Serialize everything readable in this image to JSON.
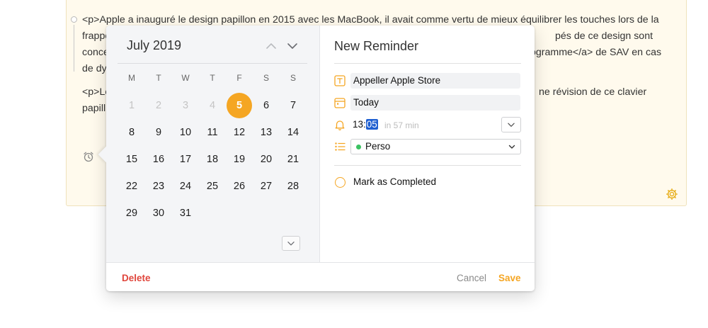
{
  "note": {
    "lines": [
      "<p>Apple a inauguré le design papillon en 2015 avec les MacBook, il avait comme vertu de mieux équilibrer les touches lors de la",
      "frappe",
      "pés de ce design sont",
      "conce",
      "ogramme</a> de SAV en cas",
      "de dy",
      "<p>Le",
      "ne révision de ce clavier",
      "papill"
    ]
  },
  "calendar": {
    "month_label": "July 2019",
    "weekdays": [
      "M",
      "T",
      "W",
      "T",
      "F",
      "S",
      "S"
    ],
    "weeks": [
      [
        {
          "d": "1",
          "muted": true
        },
        {
          "d": "2",
          "muted": true
        },
        {
          "d": "3",
          "muted": true
        },
        {
          "d": "4",
          "muted": true
        },
        {
          "d": "5",
          "selected": true
        },
        {
          "d": "6"
        },
        {
          "d": "7"
        }
      ],
      [
        {
          "d": "8"
        },
        {
          "d": "9"
        },
        {
          "d": "10"
        },
        {
          "d": "11"
        },
        {
          "d": "12"
        },
        {
          "d": "13"
        },
        {
          "d": "14"
        }
      ],
      [
        {
          "d": "15"
        },
        {
          "d": "16"
        },
        {
          "d": "17"
        },
        {
          "d": "18"
        },
        {
          "d": "19"
        },
        {
          "d": "20"
        },
        {
          "d": "21"
        }
      ],
      [
        {
          "d": "22"
        },
        {
          "d": "23"
        },
        {
          "d": "24"
        },
        {
          "d": "25"
        },
        {
          "d": "26"
        },
        {
          "d": "27"
        },
        {
          "d": "28"
        }
      ],
      [
        {
          "d": "29"
        },
        {
          "d": "30"
        },
        {
          "d": "31"
        }
      ]
    ]
  },
  "reminder": {
    "title": "New Reminder",
    "name_value": "Appeller Apple Store",
    "date_value": "Today",
    "time_hour": "13:",
    "time_minute": "05",
    "time_hint": "in 57 min",
    "list_value": "Perso",
    "list_color": "#3bc262",
    "complete_label": "Mark as Completed"
  },
  "footer": {
    "delete_label": "Delete",
    "cancel_label": "Cancel",
    "save_label": "Save"
  },
  "colors": {
    "accent": "#f5a623",
    "danger": "#e0463c",
    "selection": "#1f5fd1"
  }
}
